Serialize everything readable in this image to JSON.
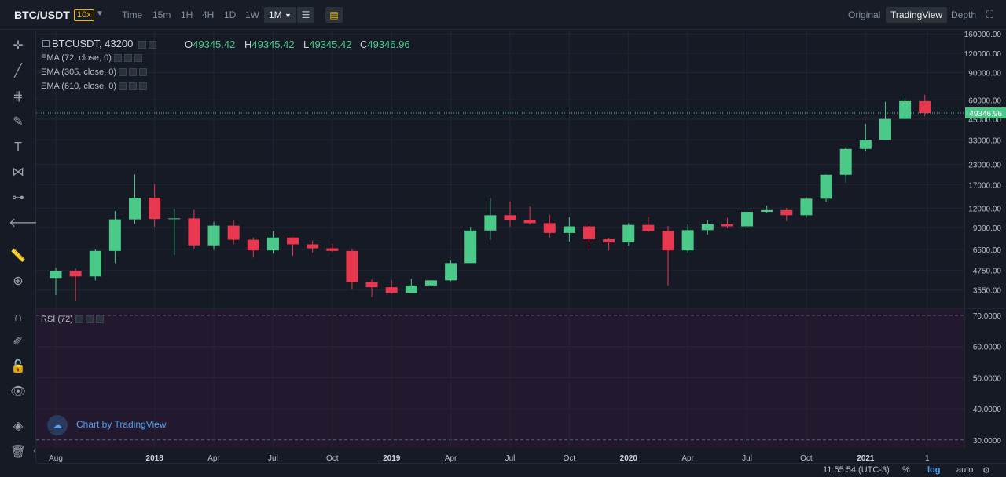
{
  "toolbar": {
    "pair": "BTC/USDT",
    "leverage": "10x",
    "intervals": [
      "Time",
      "15m",
      "1H",
      "4H",
      "1D",
      "1W"
    ],
    "active_interval": "1M",
    "views": [
      "Original",
      "TradingView",
      "Depth"
    ],
    "active_view": "TradingView"
  },
  "legend": {
    "symbol": "BTCUSDT, 43200",
    "ohlc": [
      {
        "k": "O",
        "v": "49345.42"
      },
      {
        "k": "H",
        "v": "49345.42"
      },
      {
        "k": "L",
        "v": "49345.42"
      },
      {
        "k": "C",
        "v": "49346.96"
      }
    ],
    "indicators": [
      "EMA (72, close, 0)",
      "EMA (305, close, 0)",
      "EMA (610, close, 0)"
    ],
    "rsi": "RSI (72)"
  },
  "brand": "Chart by TradingView",
  "status": {
    "clock": "11:55:54 (UTC-3)",
    "percent": "%",
    "log": "log",
    "auto": "auto"
  },
  "colors": {
    "up": "#4bc989",
    "down": "#e8384f",
    "background": "#161a25",
    "rsi_band": "#23192e",
    "price_line": "#4bc989"
  },
  "chart_data": {
    "type": "candlestick",
    "symbol": "BTCUSDT",
    "interval": "1M",
    "scale": "log",
    "last_price": "49346.96",
    "price_ticks": [
      "160000.00",
      "120000.00",
      "90000.00",
      "60000.00",
      "45000.00",
      "33000.00",
      "23000.00",
      "17000.00",
      "12000.00",
      "9000.00",
      "6500.00",
      "4750.00",
      "3550.00"
    ],
    "rsi_ticks": [
      "70.0000",
      "60.0000",
      "50.0000",
      "40.0000",
      "30.0000"
    ],
    "rsi_bands": [
      70,
      30
    ],
    "x_ticks": [
      "Aug",
      "2018",
      "Apr",
      "Jul",
      "Oct",
      "2019",
      "Apr",
      "Jul",
      "Oct",
      "2020",
      "Apr",
      "Jul",
      "Oct",
      "2021",
      "1"
    ],
    "candles": [
      {
        "date": "2017-08",
        "o": 4250,
        "h": 4950,
        "l": 3300,
        "c": 4700
      },
      {
        "date": "2017-09",
        "o": 4700,
        "h": 4900,
        "l": 3000,
        "c": 4350
      },
      {
        "date": "2017-10",
        "o": 4350,
        "h": 6500,
        "l": 4100,
        "c": 6350
      },
      {
        "date": "2017-11",
        "o": 6350,
        "h": 11500,
        "l": 5300,
        "c": 10150
      },
      {
        "date": "2017-12",
        "o": 10150,
        "h": 19800,
        "l": 9500,
        "c": 14000
      },
      {
        "date": "2018-01",
        "o": 14000,
        "h": 17150,
        "l": 9100,
        "c": 10200
      },
      {
        "date": "2018-02",
        "o": 10200,
        "h": 11800,
        "l": 6000,
        "c": 10300
      },
      {
        "date": "2018-03",
        "o": 10300,
        "h": 11700,
        "l": 6550,
        "c": 6900
      },
      {
        "date": "2018-04",
        "o": 6900,
        "h": 9800,
        "l": 6450,
        "c": 9250
      },
      {
        "date": "2018-05",
        "o": 9250,
        "h": 10000,
        "l": 7000,
        "c": 7500
      },
      {
        "date": "2018-06",
        "o": 7500,
        "h": 7750,
        "l": 5750,
        "c": 6400
      },
      {
        "date": "2018-07",
        "o": 6400,
        "h": 8500,
        "l": 6100,
        "c": 7750
      },
      {
        "date": "2018-08",
        "o": 7750,
        "h": 7800,
        "l": 5900,
        "c": 7000
      },
      {
        "date": "2018-09",
        "o": 7000,
        "h": 7400,
        "l": 6200,
        "c": 6600
      },
      {
        "date": "2018-10",
        "o": 6600,
        "h": 7050,
        "l": 6250,
        "c": 6350
      },
      {
        "date": "2018-11",
        "o": 6350,
        "h": 6550,
        "l": 3600,
        "c": 4000
      },
      {
        "date": "2018-12",
        "o": 4000,
        "h": 4150,
        "l": 3200,
        "c": 3700
      },
      {
        "date": "2019-01",
        "o": 3700,
        "h": 4100,
        "l": 3350,
        "c": 3400
      },
      {
        "date": "2019-02",
        "o": 3400,
        "h": 4200,
        "l": 3400,
        "c": 3800
      },
      {
        "date": "2019-03",
        "o": 3800,
        "h": 4100,
        "l": 3700,
        "c": 4100
      },
      {
        "date": "2019-04",
        "o": 4100,
        "h": 5500,
        "l": 4050,
        "c": 5300
      },
      {
        "date": "2019-05",
        "o": 5300,
        "h": 9100,
        "l": 5300,
        "c": 8600
      },
      {
        "date": "2019-06",
        "o": 8600,
        "h": 13900,
        "l": 7500,
        "c": 10800
      },
      {
        "date": "2019-07",
        "o": 10800,
        "h": 13200,
        "l": 9100,
        "c": 10100
      },
      {
        "date": "2019-08",
        "o": 10100,
        "h": 12300,
        "l": 9400,
        "c": 9600
      },
      {
        "date": "2019-09",
        "o": 9600,
        "h": 10900,
        "l": 7700,
        "c": 8300
      },
      {
        "date": "2019-10",
        "o": 8300,
        "h": 10500,
        "l": 7300,
        "c": 9150
      },
      {
        "date": "2019-11",
        "o": 9150,
        "h": 9400,
        "l": 6500,
        "c": 7550
      },
      {
        "date": "2019-12",
        "o": 7550,
        "h": 7700,
        "l": 6400,
        "c": 7200
      },
      {
        "date": "2020-01",
        "o": 7200,
        "h": 9600,
        "l": 6850,
        "c": 9350
      },
      {
        "date": "2020-02",
        "o": 9350,
        "h": 10500,
        "l": 8400,
        "c": 8550
      },
      {
        "date": "2020-03",
        "o": 8550,
        "h": 9200,
        "l": 3800,
        "c": 6400
      },
      {
        "date": "2020-04",
        "o": 6400,
        "h": 9450,
        "l": 6150,
        "c": 8650
      },
      {
        "date": "2020-05",
        "o": 8650,
        "h": 10050,
        "l": 8100,
        "c": 9450
      },
      {
        "date": "2020-06",
        "o": 9450,
        "h": 10400,
        "l": 8900,
        "c": 9150
      },
      {
        "date": "2020-07",
        "o": 9150,
        "h": 11400,
        "l": 8950,
        "c": 11350
      },
      {
        "date": "2020-08",
        "o": 11350,
        "h": 12450,
        "l": 11100,
        "c": 11650
      },
      {
        "date": "2020-09",
        "o": 11650,
        "h": 12050,
        "l": 9900,
        "c": 10800
      },
      {
        "date": "2020-10",
        "o": 10800,
        "h": 14100,
        "l": 10400,
        "c": 13800
      },
      {
        "date": "2020-11",
        "o": 13800,
        "h": 19800,
        "l": 13200,
        "c": 19700
      },
      {
        "date": "2020-12",
        "o": 19700,
        "h": 29300,
        "l": 17600,
        "c": 28950
      },
      {
        "date": "2021-01",
        "o": 28950,
        "h": 41900,
        "l": 28100,
        "c": 33100
      },
      {
        "date": "2021-02",
        "o": 33100,
        "h": 58300,
        "l": 33000,
        "c": 45200
      },
      {
        "date": "2021-03",
        "o": 45200,
        "h": 61800,
        "l": 45000,
        "c": 58900
      },
      {
        "date": "2021-04",
        "o": 58900,
        "h": 64800,
        "l": 47000,
        "c": 49347
      }
    ]
  }
}
